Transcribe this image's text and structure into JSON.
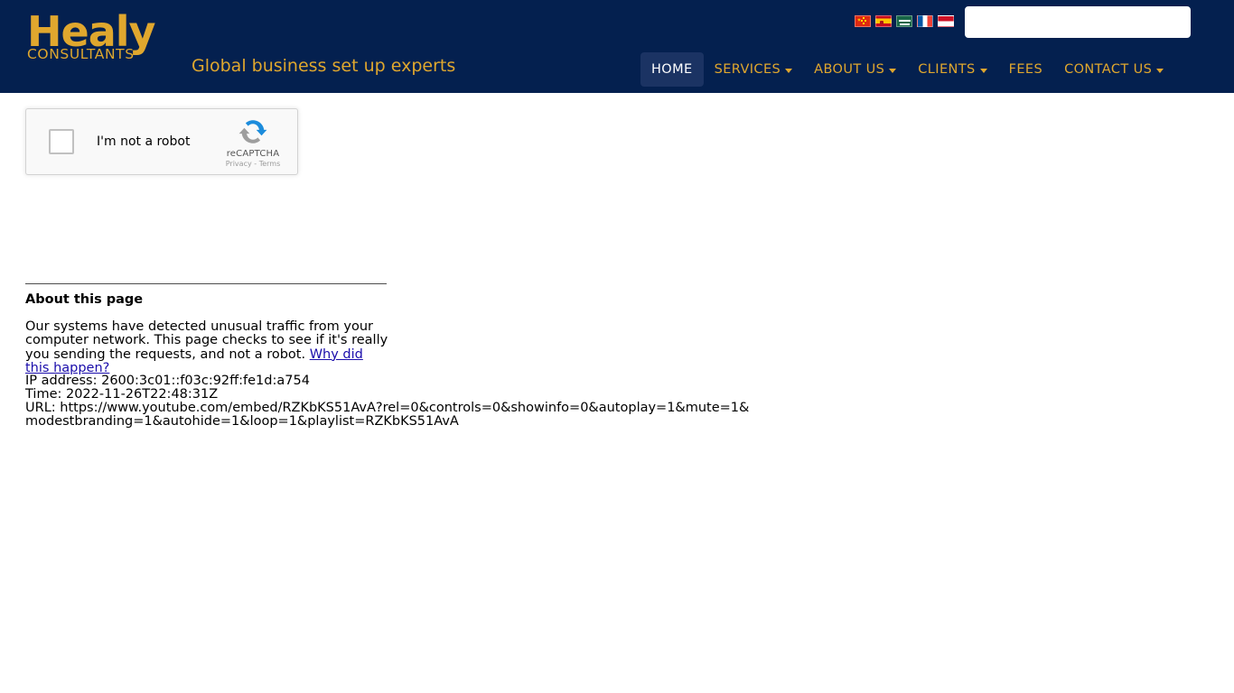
{
  "header": {
    "logo": {
      "main": "Healy",
      "sub": "CONSULTANTS"
    },
    "tagline": "Global business set up experts",
    "brand_color": "#e0a72e",
    "background_color": "#04204f",
    "flags": [
      {
        "name": "china-flag",
        "label": "Chinese"
      },
      {
        "name": "spain-flag",
        "label": "Spanish"
      },
      {
        "name": "saudi-arabia-flag",
        "label": "Arabic"
      },
      {
        "name": "france-flag",
        "label": "French"
      },
      {
        "name": "indonesia-flag",
        "label": "Indonesian"
      }
    ],
    "search": {
      "value": "",
      "placeholder": ""
    },
    "nav": [
      {
        "label": "HOME",
        "active": true,
        "caret": false
      },
      {
        "label": "SERVICES",
        "active": false,
        "caret": true
      },
      {
        "label": "ABOUT US",
        "active": false,
        "caret": true
      },
      {
        "label": "CLIENTS",
        "active": false,
        "caret": true
      },
      {
        "label": "FEES",
        "active": false,
        "caret": false
      },
      {
        "label": "CONTACT US",
        "active": false,
        "caret": true
      }
    ]
  },
  "recaptcha": {
    "checkbox_label": "I'm not a robot",
    "brand_name": "reCAPTCHA",
    "privacy_label": "Privacy",
    "separator": "-",
    "terms_label": "Terms"
  },
  "about": {
    "title": "About this page",
    "body_text": "Our systems have detected unusual traffic from your computer network. This page checks to see if it's really you sending the requests, and not a robot.",
    "link_text": "Why did this happen?",
    "ip_line": "IP address: 2600:3c01::f03c:92ff:fe1d:a754",
    "time_line": "Time: 2022-11-26T22:48:31Z",
    "url_line": "URL: https://www.youtube.com/embed/RZKbKS51AvA?rel=0&controls=0&showinfo=0&autoplay=1&mute=1&modestbranding=1&autohide=1&loop=1&playlist=RZKbKS51AvA"
  }
}
